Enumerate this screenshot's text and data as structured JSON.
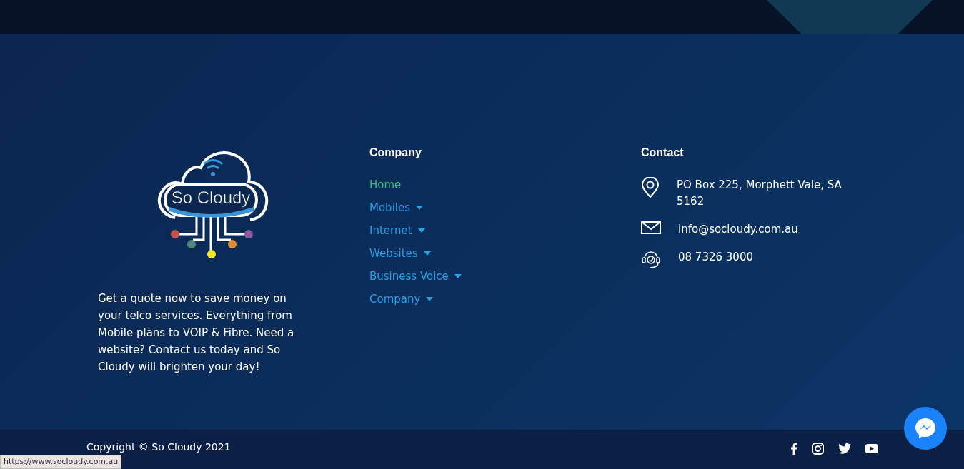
{
  "logo": {
    "text": "So Cloudy"
  },
  "about": "Get a quote now to save money on your telco services. Everything from Mobile plans to VOIP & Fibre. Need a website? Contact us today and  So Cloudy will brighten your day!",
  "company": {
    "heading": "Company",
    "items": [
      {
        "label": "Home",
        "selected": true,
        "has_dropdown": false
      },
      {
        "label": "Mobiles",
        "selected": false,
        "has_dropdown": true
      },
      {
        "label": "Internet",
        "selected": false,
        "has_dropdown": true
      },
      {
        "label": "Websites",
        "selected": false,
        "has_dropdown": true
      },
      {
        "label": "Business Voice",
        "selected": false,
        "has_dropdown": true
      },
      {
        "label": "Company",
        "selected": false,
        "has_dropdown": true
      }
    ]
  },
  "contact": {
    "heading": "Contact",
    "items": [
      {
        "kind": "address",
        "text": "PO Box 225, Morphett Vale, SA 5162"
      },
      {
        "kind": "email",
        "text": "info@socloudy.com.au"
      },
      {
        "kind": "phone",
        "text": "08 7326 3000"
      }
    ]
  },
  "footer": {
    "copyright": "Copyright © So Cloudy 2021",
    "social": [
      {
        "kind": "facebook"
      },
      {
        "kind": "instagram"
      },
      {
        "kind": "twitter"
      },
      {
        "kind": "youtube"
      }
    ]
  },
  "status_url": "https://www.socloudy.com.au"
}
